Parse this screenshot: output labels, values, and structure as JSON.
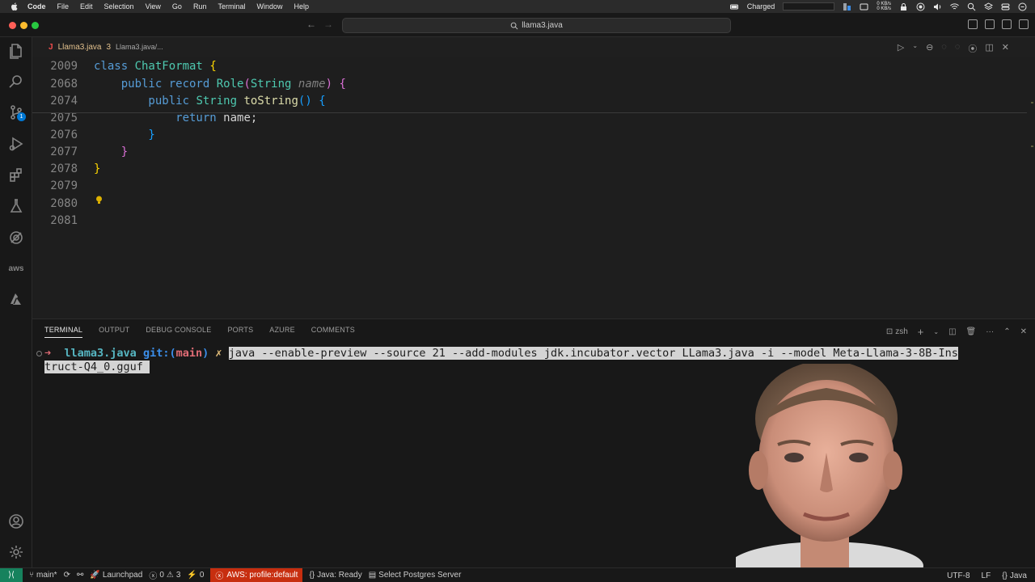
{
  "menubar": {
    "app": "Code",
    "items": [
      "File",
      "Edit",
      "Selection",
      "View",
      "Go",
      "Run",
      "Terminal",
      "Window",
      "Help"
    ],
    "battery_status": "Charged",
    "net_up": "0 KB/s",
    "net_down": "0 KB/s"
  },
  "titlebar": {
    "search_text": "llama3.java"
  },
  "activity": {
    "source_control_badge": "1",
    "aws_label": "aws"
  },
  "editor": {
    "tab_icon": "J",
    "tab_file": "Llama3.java",
    "tab_problems": "3",
    "breadcrumb": "Llama3.java/...",
    "lines": [
      {
        "num": "2009",
        "tokens": [
          {
            "t": "class ",
            "c": "kw"
          },
          {
            "t": "ChatFormat",
            "c": "ty"
          },
          {
            "t": " ",
            "c": "plain"
          },
          {
            "t": "{",
            "c": "br1"
          }
        ]
      },
      {
        "num": "2068",
        "tokens": [
          {
            "t": "    public record ",
            "c": "kw"
          },
          {
            "t": "Role",
            "c": "ty"
          },
          {
            "t": "(",
            "c": "br2"
          },
          {
            "t": "String ",
            "c": "ty"
          },
          {
            "t": "name",
            "c": "param"
          },
          {
            "t": ")",
            "c": "br2"
          },
          {
            "t": " ",
            "c": "plain"
          },
          {
            "t": "{",
            "c": "br2"
          }
        ]
      },
      {
        "num": "2074",
        "tokens": [
          {
            "t": "        public ",
            "c": "kw"
          },
          {
            "t": "String ",
            "c": "ty"
          },
          {
            "t": "toString",
            "c": "fn"
          },
          {
            "t": "() ",
            "c": "br3"
          },
          {
            "t": "{",
            "c": "br3"
          }
        ]
      },
      {
        "num": "2075",
        "tokens": [
          {
            "t": "            return ",
            "c": "kw"
          },
          {
            "t": "name;",
            "c": "plain"
          }
        ]
      },
      {
        "num": "2076",
        "tokens": [
          {
            "t": "        }",
            "c": "br3"
          }
        ]
      },
      {
        "num": "2077",
        "tokens": [
          {
            "t": "    }",
            "c": "br2"
          }
        ]
      },
      {
        "num": "2078",
        "tokens": [
          {
            "t": "}",
            "c": "br1"
          }
        ]
      },
      {
        "num": "2079",
        "tokens": []
      },
      {
        "num": "2080",
        "tokens": []
      },
      {
        "num": "2081",
        "tokens": []
      }
    ]
  },
  "panel": {
    "tabs": [
      "TERMINAL",
      "OUTPUT",
      "DEBUG CONSOLE",
      "PORTS",
      "AZURE",
      "COMMENTS"
    ],
    "active_tab": "TERMINAL",
    "shell": "zsh"
  },
  "terminal": {
    "prompt_arrow": "➜",
    "dir": "llama3.java",
    "git_label": "git:",
    "branch_open": "(",
    "branch": "main",
    "branch_close": ")",
    "dirty_mark": "✗",
    "command_line1": "java --enable-preview --source 21 --add-modules jdk.incubator.vector LLama3.java -i --model Meta-Llama-3-8B-Ins",
    "command_line2": "truct-Q4_0.gguf "
  },
  "statusbar": {
    "branch": "main*",
    "launchpad": "Launchpad",
    "errors": "0",
    "warnings": "3",
    "ports": "0",
    "aws_profile": "AWS: profile:default",
    "java_status": "Java: Ready",
    "postgres": "Select Postgres Server",
    "encoding": "UTF-8",
    "eol": "LF",
    "language": "Java"
  },
  "colors": {
    "accent_blue": "#0078d4",
    "remote_green": "#16825d",
    "aws_red": "#c72e0f"
  }
}
